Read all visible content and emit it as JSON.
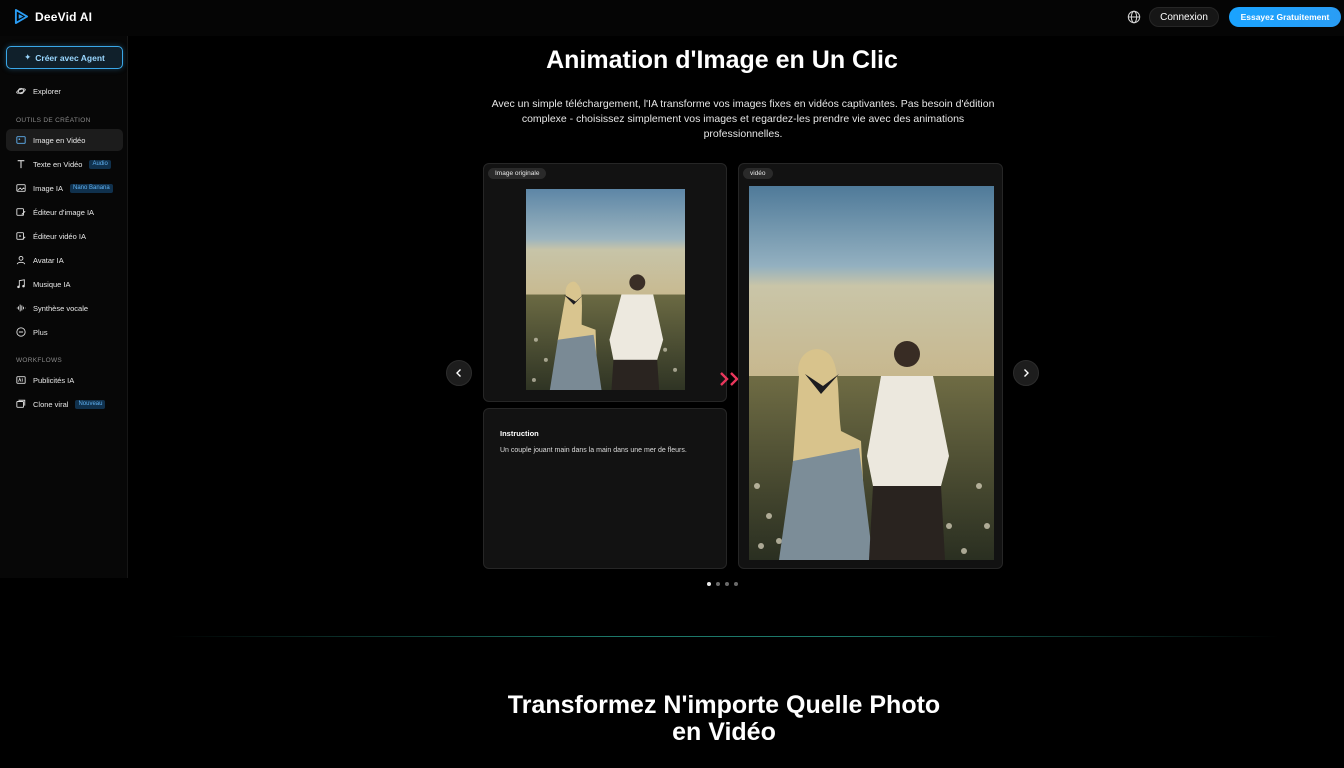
{
  "brand": {
    "name": "DeeVid AI",
    "accent": "#1aa3ff"
  },
  "header": {
    "login_label": "Connexion",
    "cta_label": "Essayez Gratuitement"
  },
  "sidebar": {
    "create_label": "Créer avec Agent",
    "explore_label": "Explorer",
    "section_tools": "OUTILS DE CRÉATION",
    "tools": [
      {
        "label": "Image en Vidéo",
        "icon": "image-icon",
        "badge": ""
      },
      {
        "label": "Texte en Vidéo",
        "icon": "text-icon",
        "badge": "Audio"
      },
      {
        "label": "Image IA",
        "icon": "image-ai-icon",
        "badge": "Nano Banana"
      },
      {
        "label": "Éditeur d'image IA",
        "icon": "image-edit-icon",
        "badge": ""
      },
      {
        "label": "Éditeur vidéo IA",
        "icon": "video-edit-icon",
        "badge": ""
      },
      {
        "label": "Avatar IA",
        "icon": "user-icon",
        "badge": ""
      },
      {
        "label": "Musique IA",
        "icon": "music-icon",
        "badge": ""
      },
      {
        "label": "Synthèse vocale",
        "icon": "waveform-icon",
        "badge": ""
      },
      {
        "label": "Plus",
        "icon": "more-icon",
        "badge": ""
      }
    ],
    "section_workflows": "WORKFLOWS",
    "workflows": [
      {
        "label": "Publicités IA",
        "icon": "ads-icon",
        "badge": ""
      },
      {
        "label": "Clone viral",
        "icon": "clone-icon",
        "badge": "Nouveau"
      }
    ]
  },
  "main": {
    "title": "Animation d'Image en Un Clic",
    "description": "Avec un simple téléchargement, l'IA transforme vos images fixes en vidéos captivantes. Pas besoin d'édition complexe - choisissez simplement vos images et regardez-les prendre vie avec des animations professionnelles.",
    "original_label": "Image originale",
    "video_label": "vidéo",
    "instruction_title": "Instruction",
    "instruction_text": "Un couple jouant main dans la main dans une mer de fleurs.",
    "carousel": {
      "slides": 4,
      "active": 0
    }
  },
  "section2": {
    "title_line1": "Transformez N'importe Quelle Photo",
    "title_line2": "en Vidéo"
  }
}
